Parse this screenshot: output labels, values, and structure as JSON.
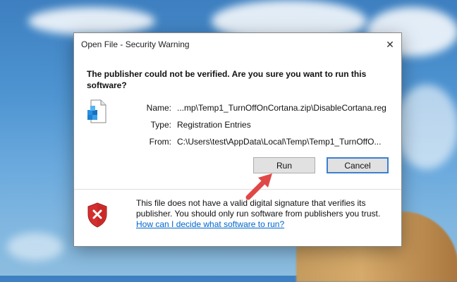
{
  "dialog": {
    "title": "Open File - Security Warning",
    "headline": "The publisher could not be verified.  Are you sure you want to run this software?",
    "fields": [
      {
        "label": "Name:",
        "value": "...mp\\Temp1_TurnOffOnCortana.zip\\DisableCortana.reg"
      },
      {
        "label": "Type:",
        "value": "Registration Entries"
      },
      {
        "label": "From:",
        "value": "C:\\Users\\test\\AppData\\Local\\Temp\\Temp1_TurnOffO..."
      }
    ],
    "run_label": "Run",
    "cancel_label": "Cancel",
    "warning_text": "This file does not have a valid digital signature that verifies its publisher.  You should only run software from publishers you trust.",
    "help_link": "How can I decide what software to run?"
  },
  "icons": {
    "close": "close-icon",
    "file": "registry-file-icon",
    "shield": "shield-warning-icon",
    "arrow": "red-arrow-annotation"
  },
  "colors": {
    "accent": "#3c7fd0",
    "link": "#0066cc",
    "shield": "#d32f2f",
    "arrow": "#e04848"
  }
}
